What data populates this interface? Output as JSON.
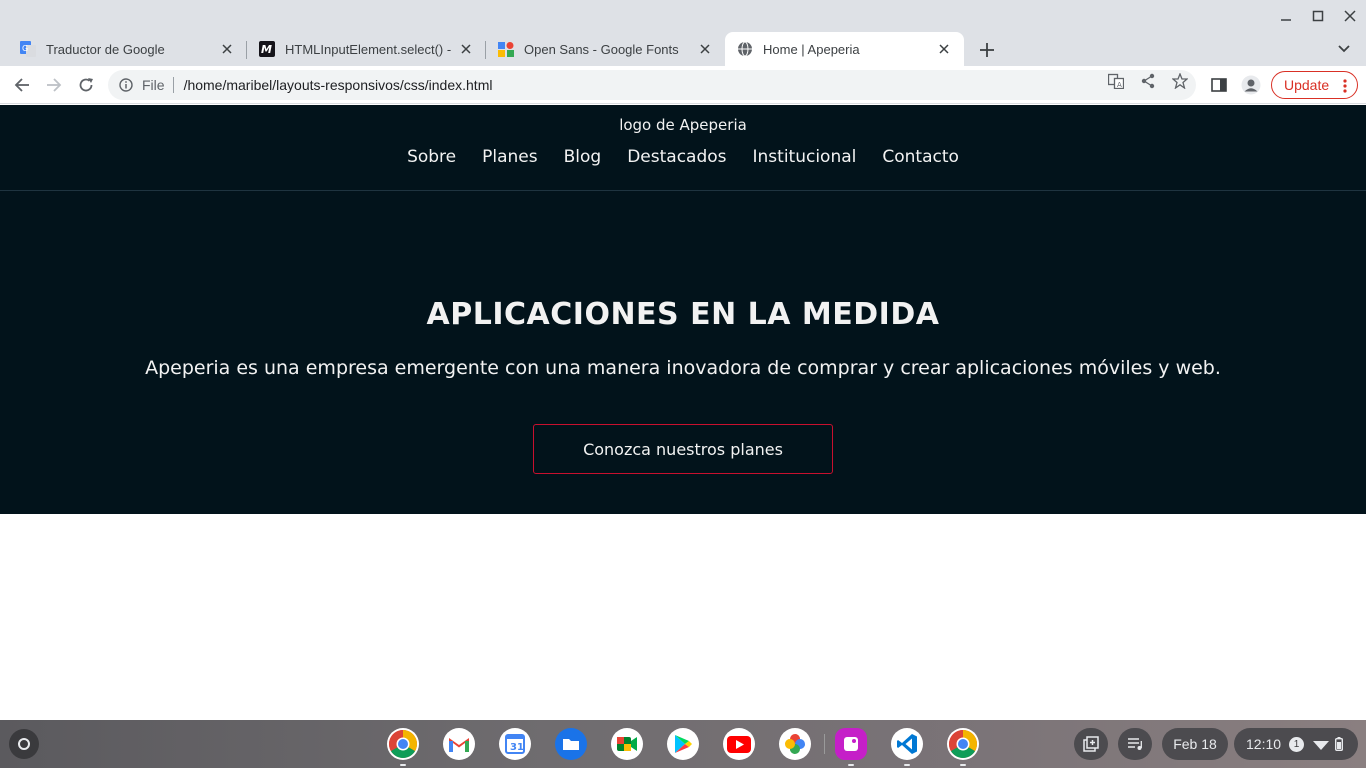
{
  "browser": {
    "tabs": [
      {
        "title": "Traductor de Google",
        "favicon": "google-translate-icon",
        "active": false
      },
      {
        "title": "HTMLInputElement.select() - W",
        "favicon": "mdn-icon",
        "active": false
      },
      {
        "title": "Open Sans - Google Fonts",
        "favicon": "google-fonts-icon",
        "active": false
      },
      {
        "title": "Home | Apeperia",
        "favicon": "globe-icon",
        "active": true
      }
    ],
    "address": {
      "scheme": "File",
      "url": "/home/maribel/layouts-responsivos/css/index.html"
    },
    "update_label": "Update",
    "colors": {
      "tabstrip": "#dee1e6",
      "omnibox": "#f1f3f4",
      "update": "#d93025"
    }
  },
  "site": {
    "logo_alt": "logo de Apeperia",
    "nav": [
      "Sobre",
      "Planes",
      "Blog",
      "Destacados",
      "Institucional",
      "Contacto"
    ],
    "hero": {
      "title": "APLICACIONES EN LA MEDIDA",
      "subtitle": "Apeperia es una empresa emergente con una manera inovadora de comprar y crear aplicaciones móviles y web.",
      "cta": "Conozca nuestros planes"
    },
    "colors": {
      "background": "#02131b",
      "text": "#f2f2f2",
      "cta_border": "#c8102e"
    }
  },
  "shelf": {
    "apps": [
      "chrome-icon",
      "gmail-icon",
      "calendar-icon",
      "files-icon",
      "meet-icon",
      "play-store-icon",
      "youtube-icon",
      "photos-icon",
      "gallery-icon",
      "vscode-icon",
      "chrome-icon"
    ],
    "date": "Feb 18",
    "time": "12:10",
    "notifications": "1"
  }
}
